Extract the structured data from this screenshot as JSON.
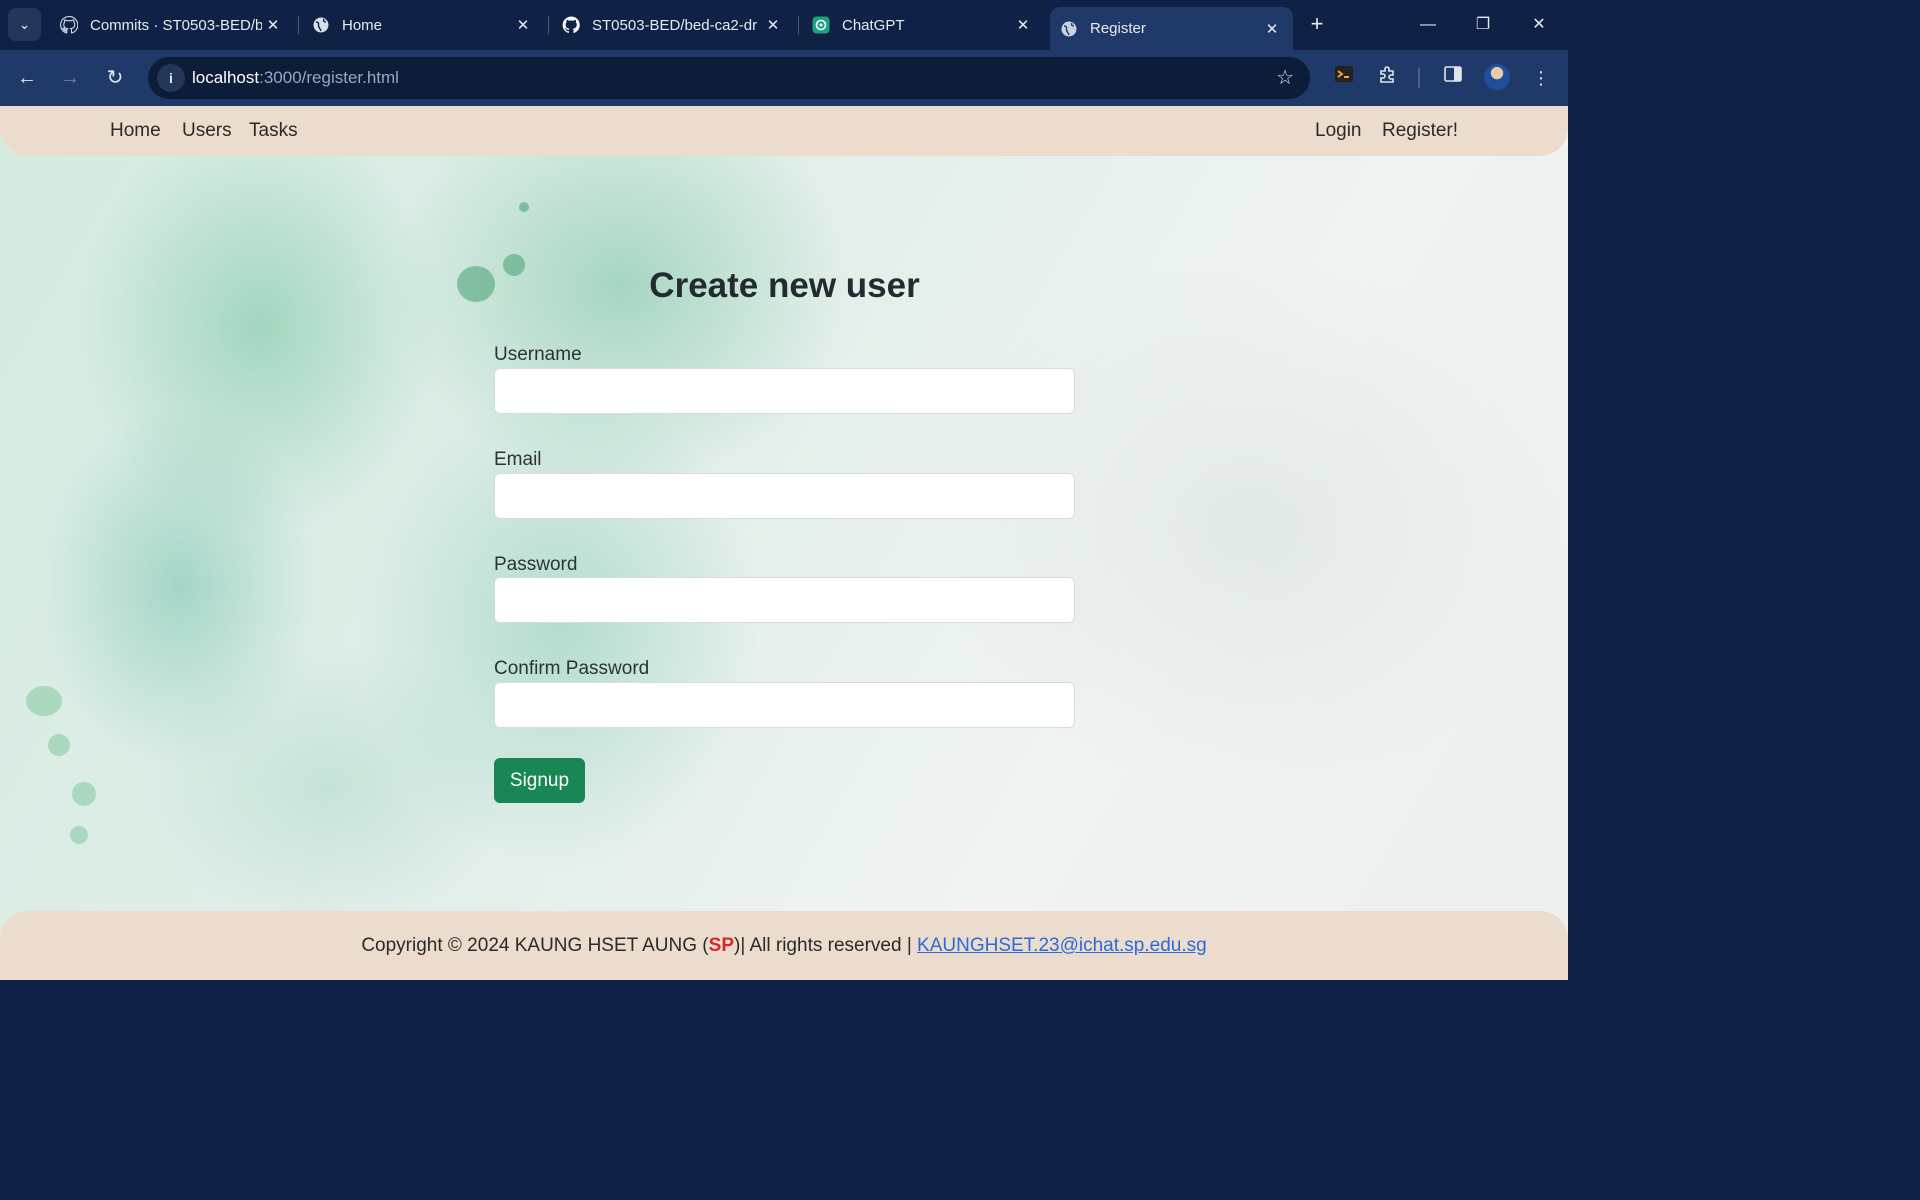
{
  "browser": {
    "tabs": [
      {
        "title": "Commits · ST0503-BED/b",
        "icon": "github-icon"
      },
      {
        "title": "Home",
        "icon": "globe-icon"
      },
      {
        "title": "ST0503-BED/bed-ca2-dr",
        "icon": "github-icon"
      },
      {
        "title": "ChatGPT",
        "icon": "chatgpt-icon"
      },
      {
        "title": "Register",
        "icon": "globe-icon",
        "active": true
      }
    ],
    "url_host": "localhost",
    "url_rest": ":3000/register.html"
  },
  "site_nav": {
    "left": [
      "Home",
      "Users",
      "Tasks"
    ],
    "right": [
      "Login",
      "Register!"
    ]
  },
  "form": {
    "title": "Create new user",
    "fields": [
      {
        "label": "Username",
        "value": ""
      },
      {
        "label": "Email",
        "value": ""
      },
      {
        "label": "Password",
        "value": ""
      },
      {
        "label": "Confirm Password",
        "value": ""
      }
    ],
    "submit_label": "Signup"
  },
  "footer": {
    "prefix": "Copyright © 2024 KAUNG HSET AUNG (",
    "highlight": "SP",
    "suffix": ")| All rights reserved | ",
    "email": "KAUNGHSET.23@ichat.sp.edu.sg"
  },
  "colors": {
    "nav_bg": "#ecdccd",
    "button_green": "#198754",
    "browser_dark": "#0f2246",
    "browser_toolbar": "#1f3a68",
    "link": "#2a6bd8",
    "highlight_red": "#d62828"
  }
}
